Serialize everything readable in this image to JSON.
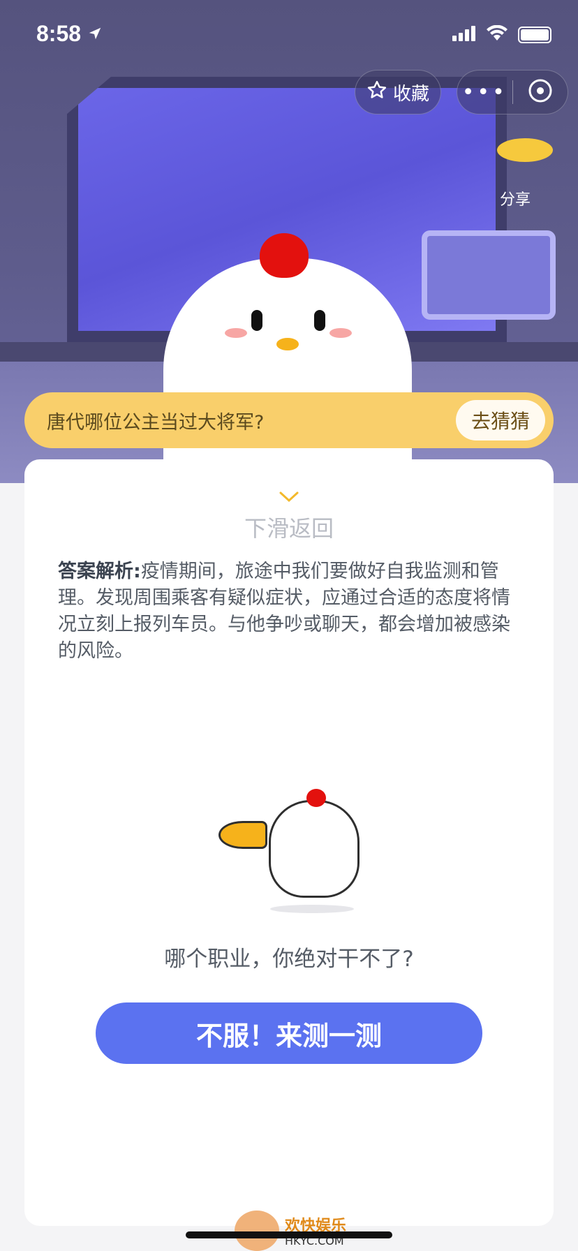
{
  "status_bar": {
    "time": "8:58"
  },
  "top_controls": {
    "favorite_label": "收藏",
    "share_label": "分享"
  },
  "question_bar": {
    "question": "唐代哪位公主当过大将军?",
    "guess_label": "去猜猜"
  },
  "card": {
    "swipe_back_label": "下滑返回",
    "analysis_title": "答案解析:",
    "analysis_body": "疫情期间，旅途中我们要做好自我监测和管理。发现周围乘客有疑似症状，应通过合适的态度将情况立刻上报列车员。与他争吵或聊天，都会增加被感染的风险。",
    "promo_question": "哪个职业，你绝对干不了?",
    "cta_label": "不服！来测一测"
  },
  "watermark": {
    "title": "欢快娱乐",
    "url": "HKYC.COM"
  },
  "colors": {
    "question_bar_bg": "#f9cf6b",
    "cta_bg": "#5b72f0",
    "chevron": "#f3b92b"
  },
  "icons": [
    "location-arrow-icon",
    "signal-icon",
    "wifi-icon",
    "battery-icon",
    "star-icon",
    "more-dots-icon",
    "close-circle-icon",
    "chevron-down-icon"
  ]
}
